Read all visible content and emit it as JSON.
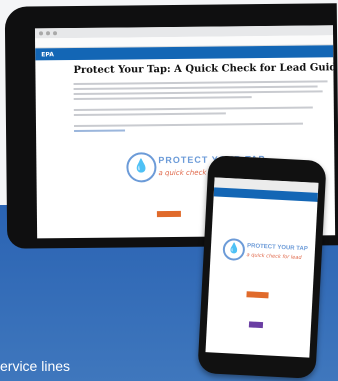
{
  "tablet": {
    "nav_logo": "EPA",
    "page_title": "Protect Your Tap: A Quick Check for Lead Guide",
    "emblem_title": "PROTECT YOUR TAP",
    "emblem_subtitle": "a quick check for lead"
  },
  "phone": {
    "emblem_title": "PROTECT YOUR TAP",
    "emblem_subtitle": "a quick check for lead"
  },
  "caption": "ervice lines",
  "colors": {
    "brand_blue": "#1366b5",
    "background_blue": "#2c5fa8",
    "accent_orange": "#e06a2b",
    "accent_purple": "#6a3ea3"
  }
}
